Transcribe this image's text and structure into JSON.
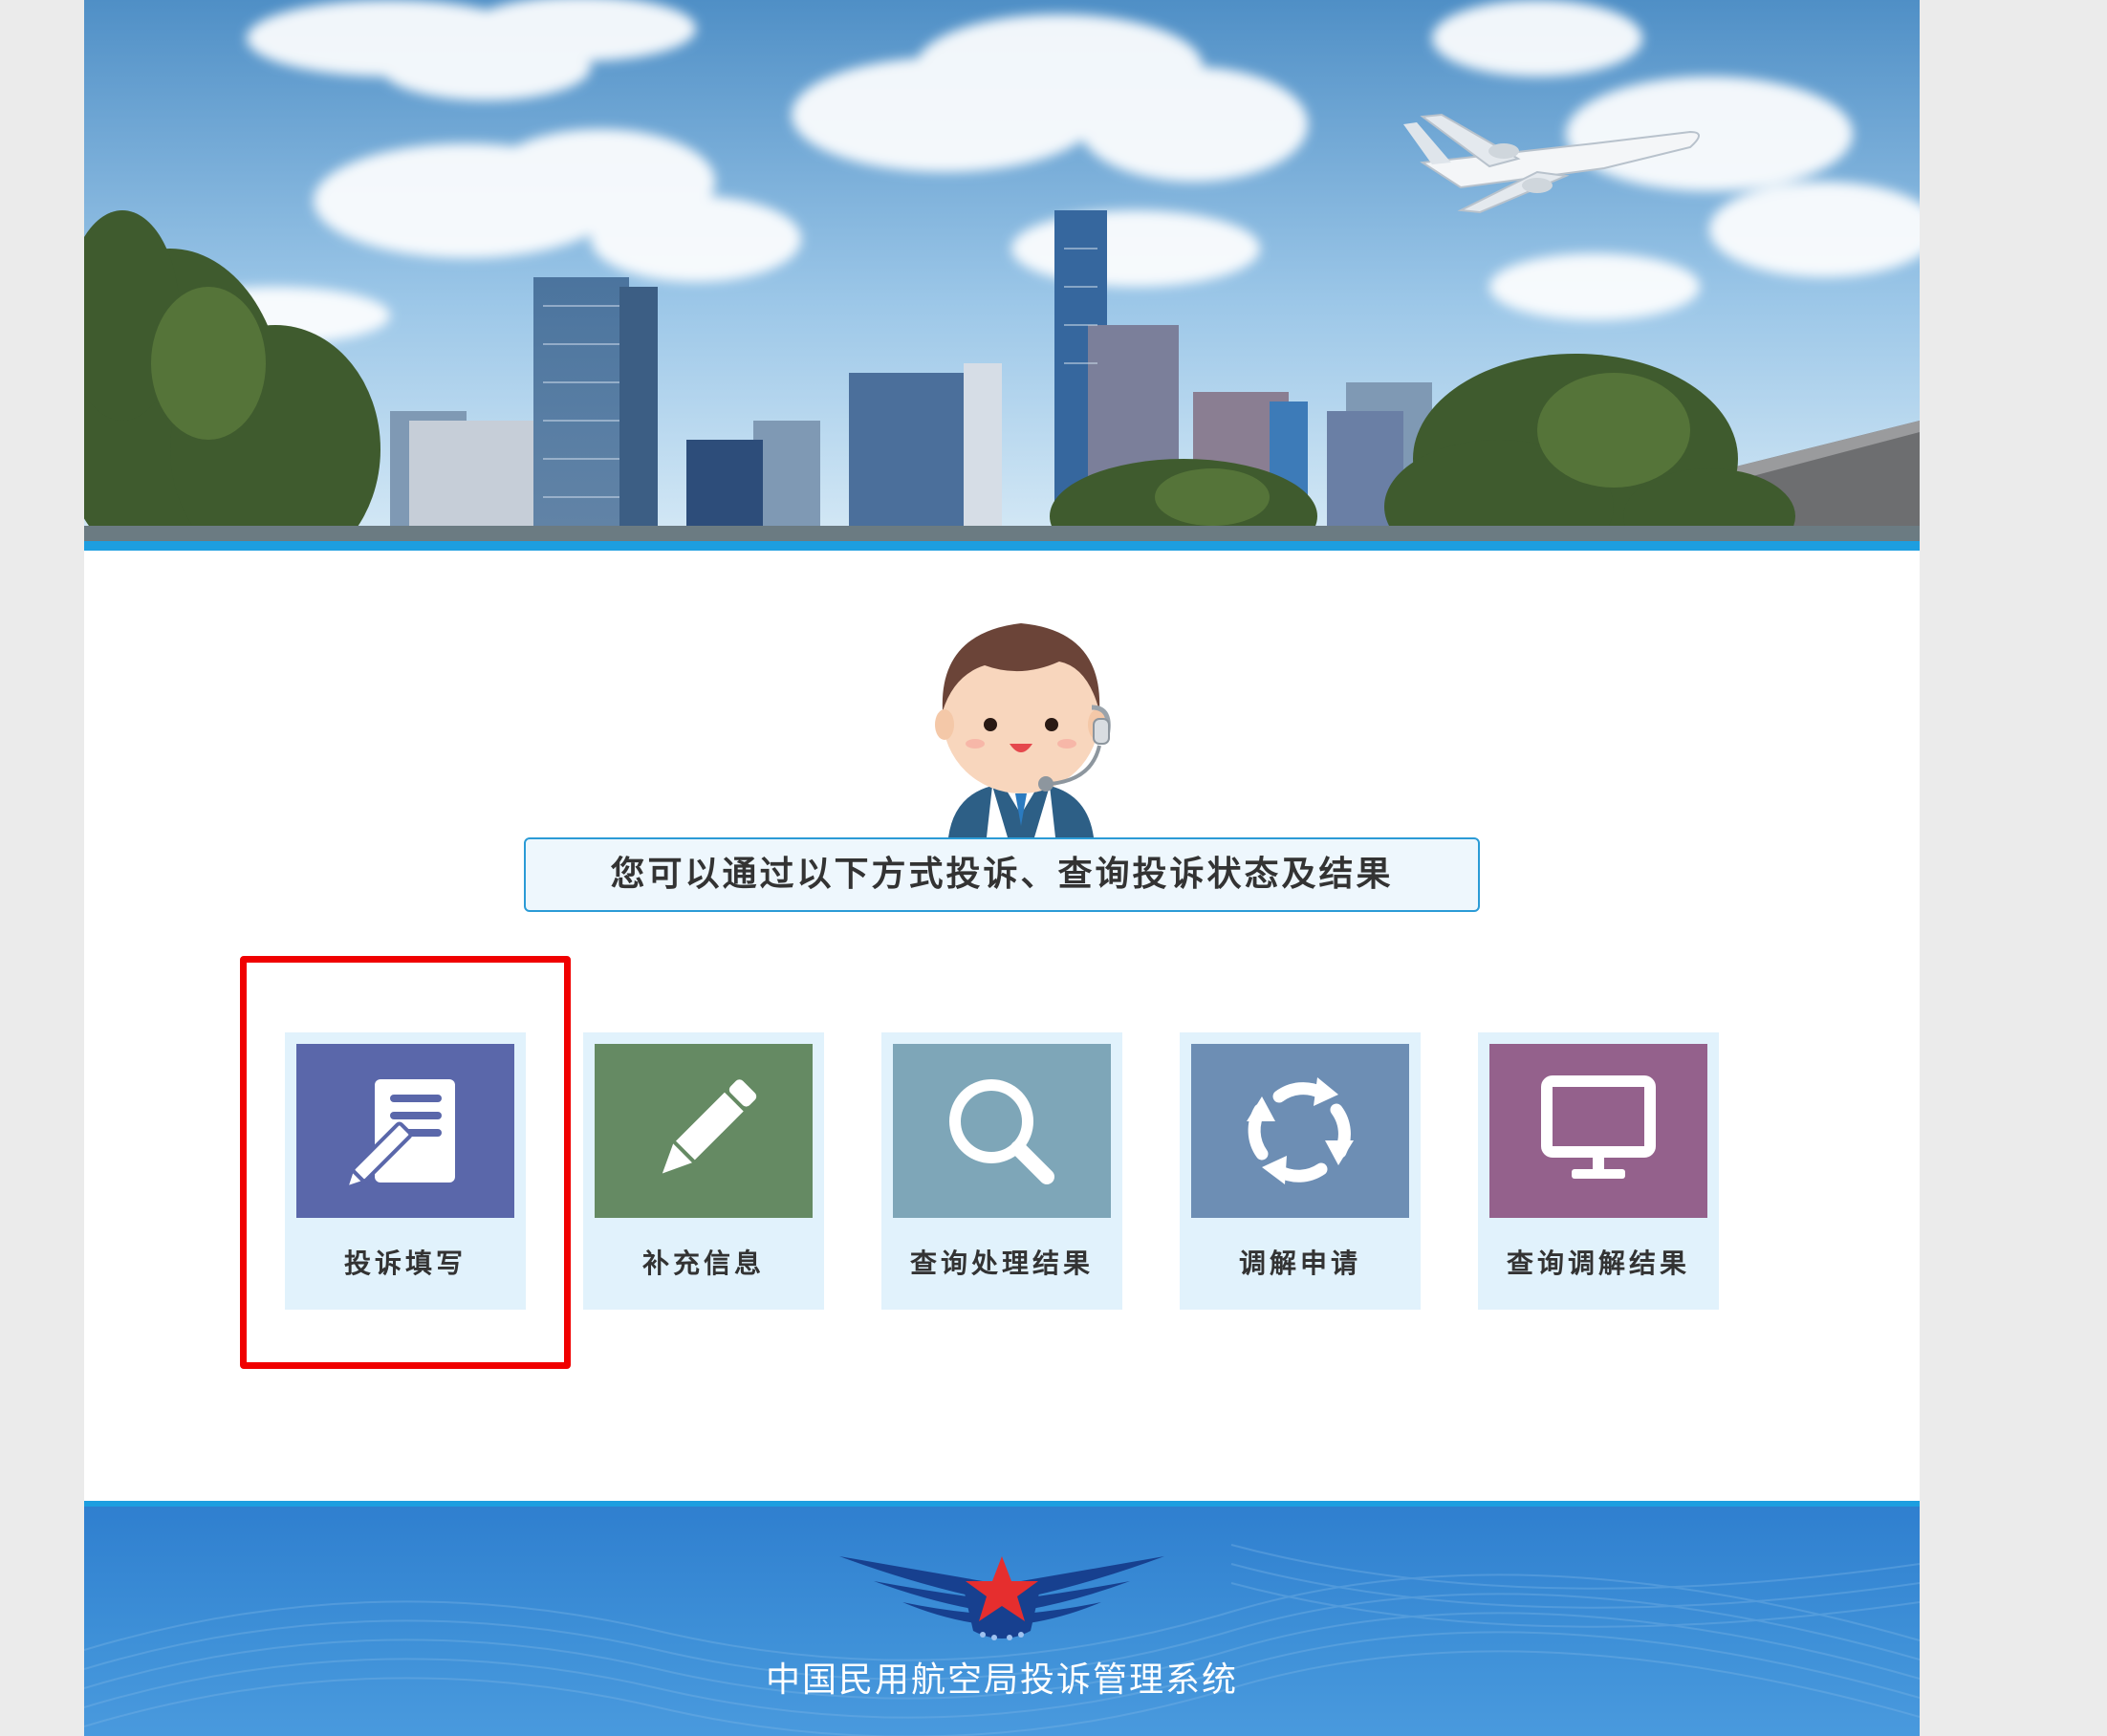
{
  "headline": "您可以通过以下方式投诉、查询投诉状态及结果",
  "tiles": [
    {
      "label": "投诉填写",
      "icon": "complaint-form-icon",
      "color": "#5a67aa"
    },
    {
      "label": "补充信息",
      "icon": "pencil-icon",
      "color": "#658a63"
    },
    {
      "label": "查询处理结果",
      "icon": "magnifier-icon",
      "color": "#7ea6b8"
    },
    {
      "label": "调解申请",
      "icon": "refresh-cycle-icon",
      "color": "#6d8eb4"
    },
    {
      "label": "查询调解结果",
      "icon": "monitor-icon",
      "color": "#94618c"
    }
  ],
  "highlight_color": "#f00000",
  "footer": {
    "title": "中国民用航空局投诉管理系统"
  },
  "colors": {
    "accent": "#1d9ee0",
    "tile_bg": "#e1f2fc",
    "footer_bg": "#3a8bd4"
  }
}
